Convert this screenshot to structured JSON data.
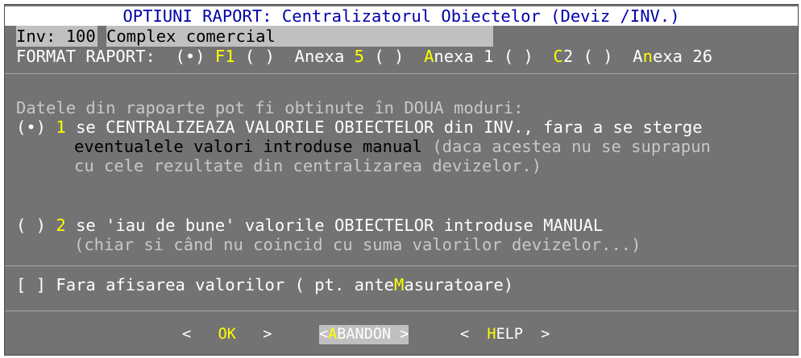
{
  "dialog": {
    "title": "OPTIUNI RAPORT: Centralizatorul Obiectelor (Deviz /INV.)",
    "inv_label": "Inv: 100",
    "inv_name": "Complex comercial"
  },
  "format": {
    "label": "FORMAT RAPORT:",
    "options": [
      {
        "marker": "(•)",
        "hot": "F",
        "rest": "1"
      },
      {
        "marker": "( )",
        "pre": "Anexa ",
        "hot": "5"
      },
      {
        "marker": "( )",
        "hot": "A",
        "rest": "nexa 1"
      },
      {
        "marker": "( )",
        "hot": "C",
        "rest": "2"
      },
      {
        "marker": "( )",
        "pre": "A",
        "hot": "n",
        "rest": "exa 26"
      }
    ]
  },
  "modes": {
    "intro": "Datele din rapoarte pot fi obtinute în DOUA moduri:",
    "option1": {
      "marker": "(•)",
      "num": "1",
      "line1": "se CENTRALIZEAZA VALORILE OBIECTELOR din INV., fara a se sterge",
      "line2_main": "eventualele valori introduse manual",
      "line2_note": " (daca acestea nu se suprapun",
      "line3": "cu cele rezultate din centralizarea devizelor.)"
    },
    "option2": {
      "marker": "( )",
      "num": "2",
      "line1": "se 'iau de bune' valorile OBIECTELOR introduse MANUAL",
      "line2": "(chiar si când nu coincid cu suma valorilor devizelor...)"
    }
  },
  "checkbox": {
    "marker": "[ ]",
    "pre": "Fara afisarea valorilor ( pt. ante",
    "hot": "M",
    "post": "asuratoare)"
  },
  "buttons": {
    "ok": {
      "left": "<   ",
      "hot": "OK",
      "right": "   >"
    },
    "abandon": {
      "left": "<",
      "hot": "A",
      "rest": "BANDON >"
    },
    "help": {
      "left": "<  ",
      "hot": "H",
      "rest": "ELP  >"
    }
  }
}
